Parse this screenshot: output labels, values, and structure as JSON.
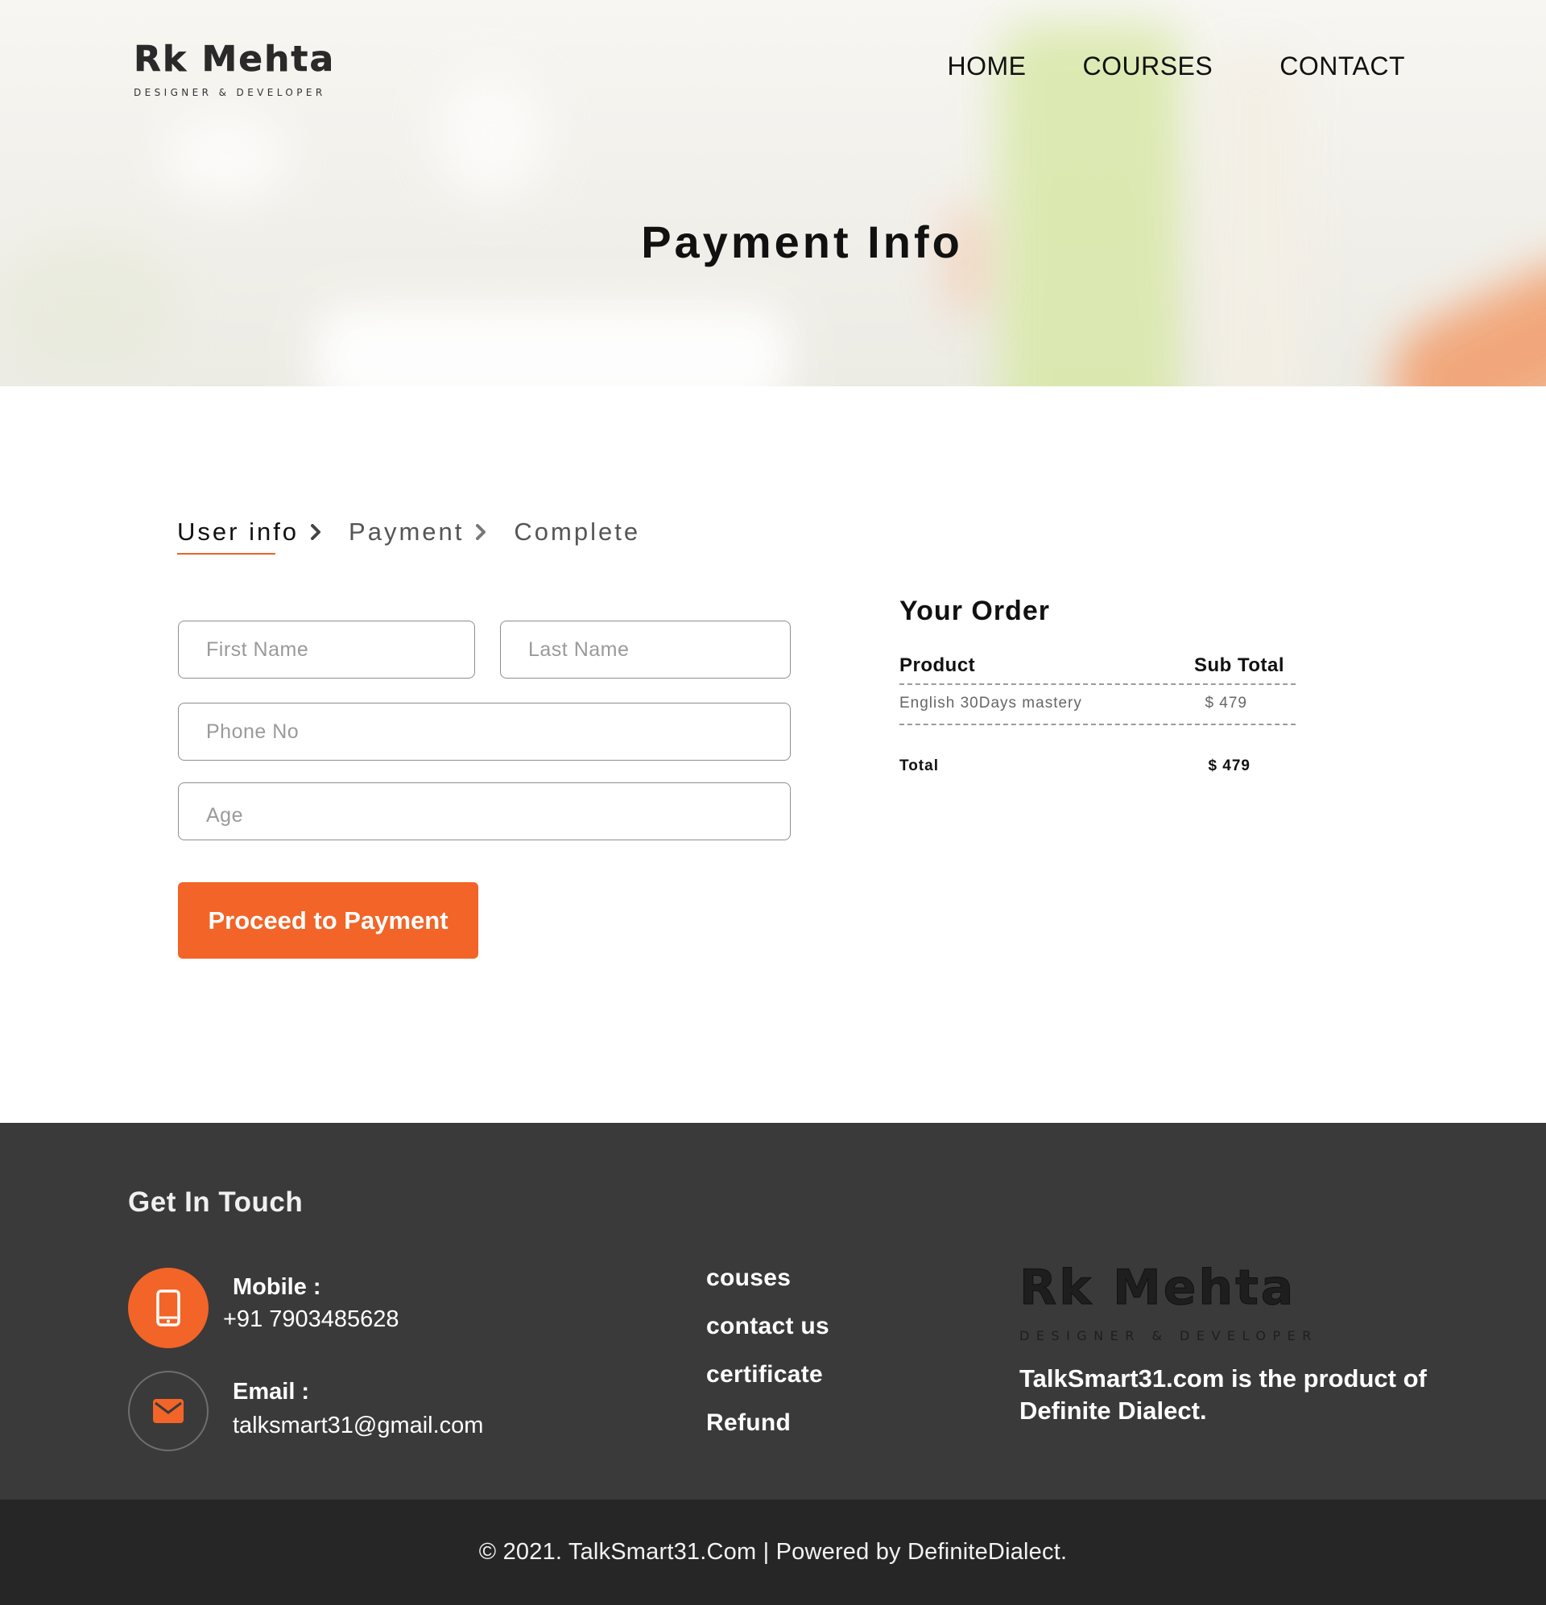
{
  "brand": {
    "name": "Rk Mehta",
    "tagline": "DESIGNER & DEVELOPER"
  },
  "nav": {
    "items": [
      {
        "label": "HOME"
      },
      {
        "label": "COURSES"
      },
      {
        "label": "CONTACT"
      }
    ]
  },
  "hero": {
    "title": "Payment Info"
  },
  "steps": {
    "items": [
      {
        "label": "User info",
        "active": true
      },
      {
        "label": "Payment",
        "active": false
      },
      {
        "label": "Complete",
        "active": false
      }
    ]
  },
  "form": {
    "first_name": {
      "placeholder": "First Name",
      "value": ""
    },
    "last_name": {
      "placeholder": "Last Name",
      "value": ""
    },
    "phone": {
      "placeholder": "Phone No",
      "value": ""
    },
    "age": {
      "placeholder": "Age",
      "value": ""
    },
    "submit_label": "Proceed to Payment"
  },
  "order": {
    "title": "Your Order",
    "columns": {
      "product": "Product",
      "subtotal": "Sub Total"
    },
    "items": [
      {
        "product": "English 30Days mastery",
        "subtotal": "$ 479"
      }
    ],
    "total_label": "Total",
    "total_value": "$ 479"
  },
  "footer": {
    "title": "Get In Touch",
    "mobile_label": "Mobile :",
    "mobile_value": "+91 7903485628",
    "email_label": "Email :",
    "email_value": "talksmart31@gmail.com",
    "links": [
      {
        "label": "couses"
      },
      {
        "label": "contact us"
      },
      {
        "label": "certificate"
      },
      {
        "label": "Refund"
      }
    ],
    "about": "TalkSmart31.com is the product of Definite Dialect.",
    "copyright": "© 2021. TalkSmart31.Com | Powered by DefiniteDialect."
  },
  "colors": {
    "accent": "#f26427",
    "footer_bg": "#3a3a3a",
    "copyright_bg": "#262626"
  },
  "icons": {
    "step_separator": "chevron-right-icon",
    "mobile": "phone-icon",
    "email": "mail-icon"
  }
}
